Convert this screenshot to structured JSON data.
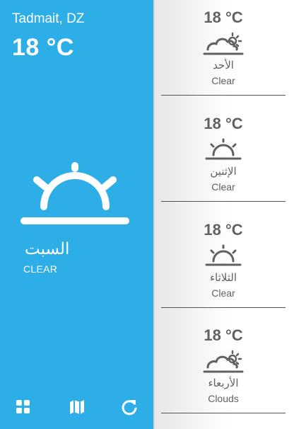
{
  "current": {
    "location": "Tadmait, DZ",
    "temperature": "18 °C",
    "day": "السبت",
    "condition": "CLEAR",
    "icon": "sunrise-icon"
  },
  "forecast": [
    {
      "temp": "18 °C",
      "day": "الأحد",
      "condition": "Clear",
      "icon": "partly-cloudy-icon"
    },
    {
      "temp": "18 °C",
      "day": "الإثنين",
      "condition": "Clear",
      "icon": "sunrise-icon"
    },
    {
      "temp": "18 °C",
      "day": "الثلاثاء",
      "condition": "Clear",
      "icon": "sunrise-icon"
    },
    {
      "temp": "18 °C",
      "day": "الأربعاء",
      "condition": "Clouds",
      "icon": "partly-cloudy-icon"
    }
  ],
  "toolbar": {
    "icons": [
      "grid-icon",
      "map-icon",
      "refresh-icon"
    ]
  },
  "colors": {
    "accent": "#2eaee6",
    "text_dark": "#616161"
  }
}
